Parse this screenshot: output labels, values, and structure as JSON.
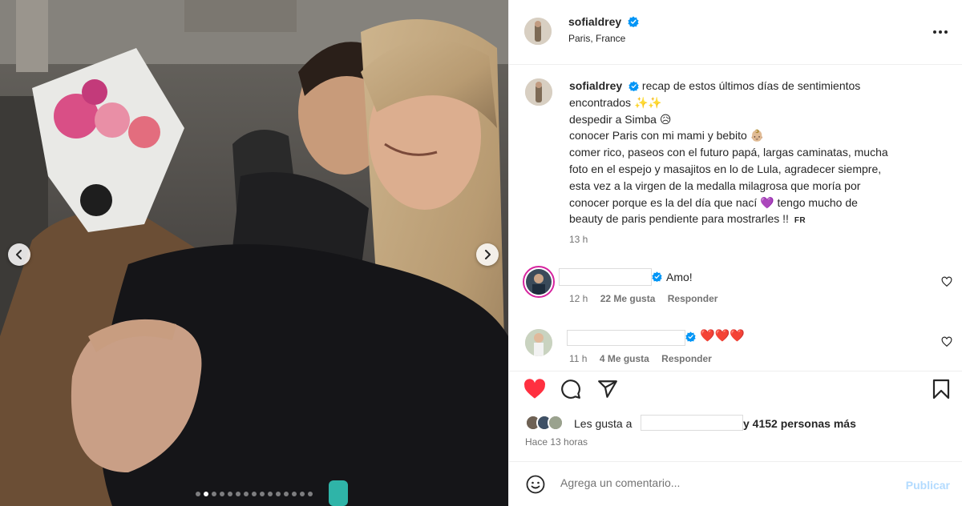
{
  "post": {
    "username": "sofialdrey",
    "location": "Paris, France",
    "more_icon": "more-options-icon"
  },
  "caption": {
    "username": "sofialdrey",
    "lines": [
      "recap de estos últimos días de sentimientos",
      "encontrados ✨✨",
      "despedir a Simba 😥",
      "conocer Paris con mi mami y bebito 👶🏼",
      "comer rico, paseos con el futuro papá, largas caminatas, mucha",
      "foto en el espejo y masajitos en lo de Lula, agradecer siempre,",
      "esta vez a la virgen de la medalla milagrosa que moría por",
      "conocer porque es la del día que nací 💜 tengo mucho de",
      "beauty de paris pendiente para mostrarles !!"
    ],
    "translate_label": "FR",
    "time": "13 h"
  },
  "comments": [
    {
      "text": "Amo!",
      "time": "12 h",
      "likes": "22 Me gusta",
      "reply": "Responder"
    },
    {
      "text": "❤️❤️❤️",
      "time": "11 h",
      "likes": "4 Me gusta",
      "reply": "Responder"
    }
  ],
  "likes": {
    "prefix": "Les gusta a",
    "suffix": "y 4152 personas más"
  },
  "posted": "Hace 13 horas",
  "composer": {
    "placeholder": "Agrega un comentario...",
    "publish": "Publicar"
  },
  "carousel": {
    "slide_count": 15,
    "active_index": 1
  },
  "colors": {
    "like_red": "#ff3040",
    "verified_blue": "#0095f6",
    "publish_disabled": "#b3dbff"
  }
}
